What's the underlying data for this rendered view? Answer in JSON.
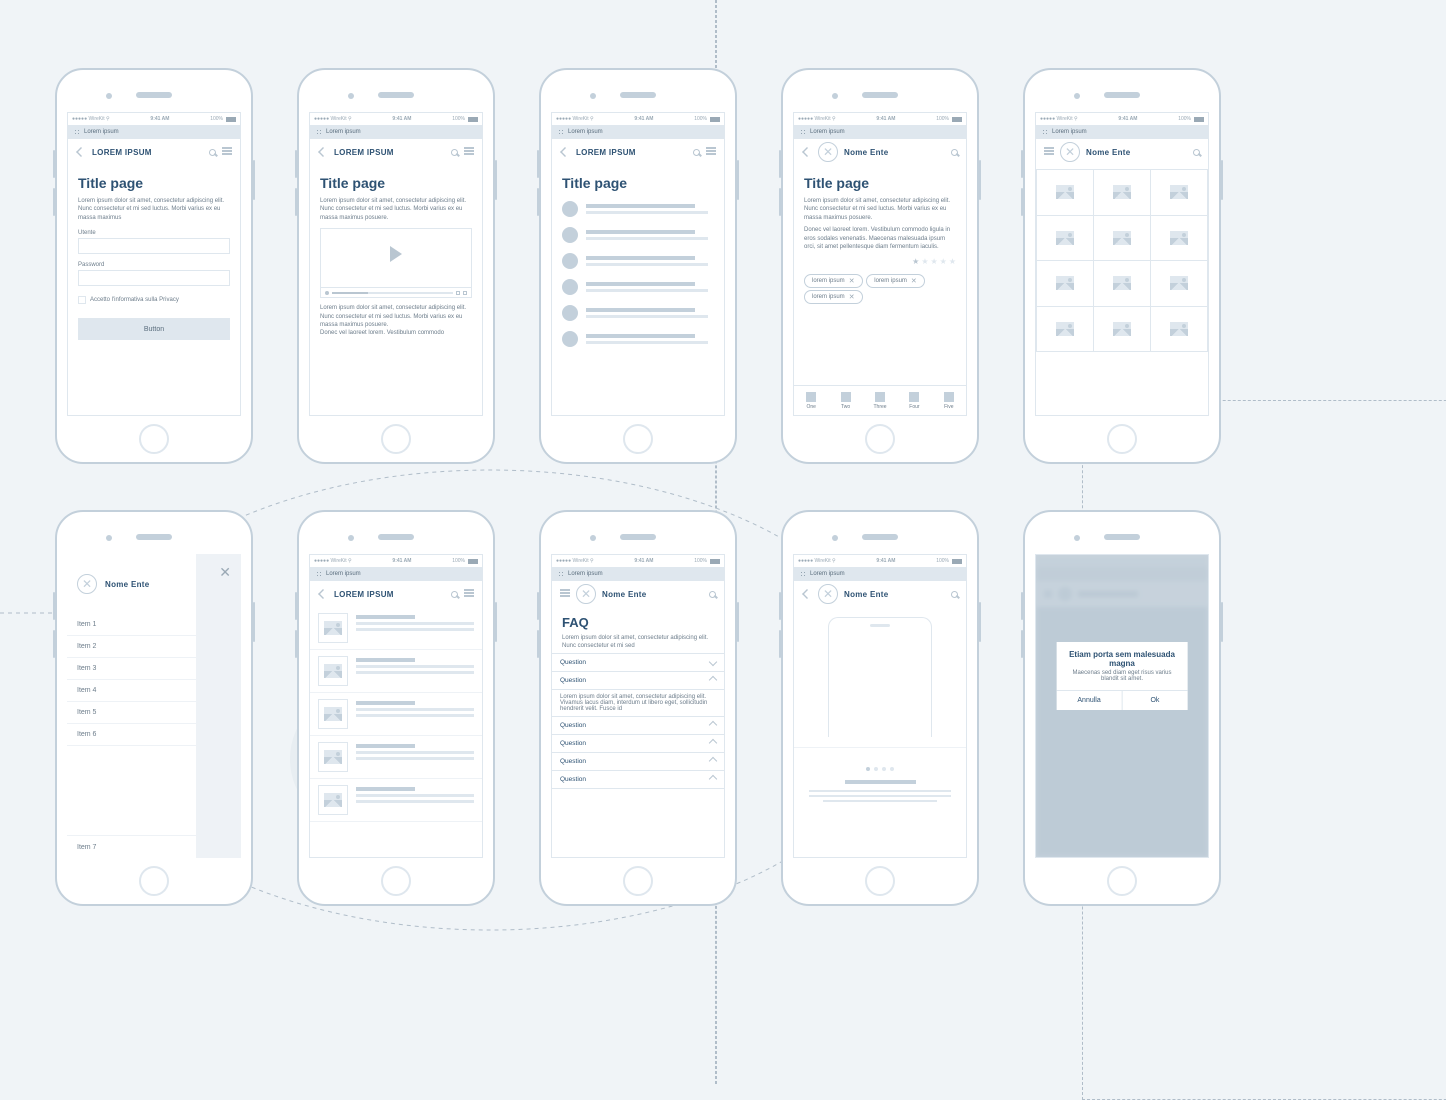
{
  "status": {
    "carrier": "●●●●● WireKit ⚲",
    "time": "9:41 AM",
    "battery": "100%"
  },
  "appbar": "Lorem ipsum",
  "screens": {
    "s1": {
      "nav": "LOREM IPSUM",
      "title": "Title page",
      "body": "Lorem ipsum dolor sit amet, consectetur adipiscing elit. Nunc consectetur et mi sed luctus. Morbi varius ex eu massa maximus",
      "user_label": "Utente",
      "pass_label": "Password",
      "check": "Accetto l'informativa sulla Privacy",
      "button": "Button"
    },
    "s2": {
      "nav": "LOREM IPSUM",
      "title": "Title page",
      "body": "Lorem ipsum dolor sit amet, consectetur adipiscing elit. Nunc consectetur et mi sed luctus. Morbi varius ex eu massa maximus posuere.",
      "body2": "Lorem ipsum dolor sit amet, consectetur adipiscing elit. Nunc consectetur et mi sed luctus. Morbi varius ex eu massa maximus posuere.",
      "body3": "Donec vel laoreet lorem. Vestibulum commodo"
    },
    "s3": {
      "nav": "LOREM IPSUM",
      "title": "Title page"
    },
    "s4": {
      "nav": "Nome Ente",
      "title": "Title page",
      "body": "Lorem ipsum dolor sit amet, consectetur adipiscing elit. Nunc consectetur et mi sed luctus. Morbi varius ex eu massa maximus posuere.",
      "body2": "Donec vel laoreet lorem. Vestibulum commodo ligula in eros sodales venenatis. Maecenas malesuada ipsum orci, sit amet pellentesque diam fermentum iaculis.",
      "chips": [
        "lorem ipsum",
        "lorem ipsum",
        "lorem ipsum"
      ],
      "tabs": [
        "One",
        "Two",
        "Three",
        "Four",
        "Five"
      ]
    },
    "s5": {
      "nav": "Nome Ente"
    },
    "s6": {
      "brand": "Nome Ente",
      "items": [
        "Item 1",
        "Item 2",
        "Item 3",
        "Item 4",
        "Item 5",
        "Item 6"
      ],
      "last": "Item 7"
    },
    "s7": {
      "nav": "LOREM IPSUM"
    },
    "s8": {
      "nav": "Nome Ente",
      "title": "FAQ",
      "body": "Lorem ipsum dolor sit amet, consectetur adipiscing elit. Nunc consectetur et mi sed",
      "q": "Question",
      "ans": "Lorem ipsum dolor sit amet, consectetur adipiscing elit. Vivamus lacus diam, interdum ut libero eget, sollicitudin hendrerit velit. Fusce id"
    },
    "s9": {
      "nav": "Nome Ente"
    },
    "s10": {
      "title": "Etiam porta sem malesuada magna",
      "body": "Maecenas sed diam eget risus varius blandit sit amet.",
      "cancel": "Annulla",
      "ok": "Ok"
    }
  }
}
